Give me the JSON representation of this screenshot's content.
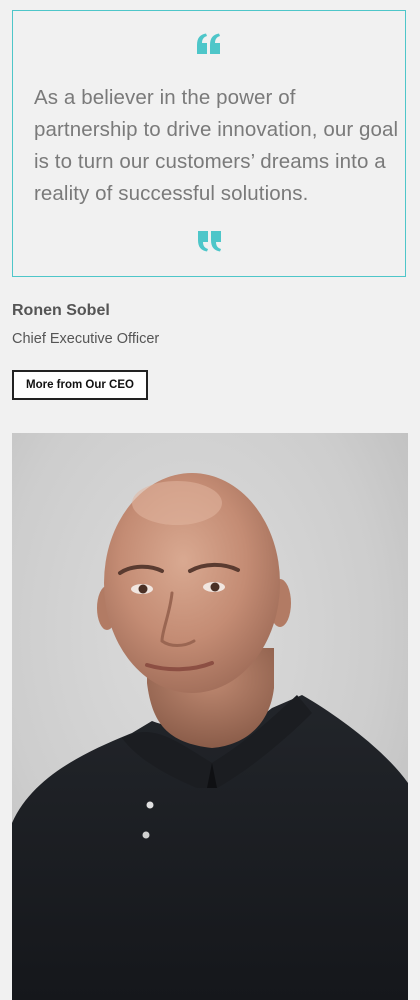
{
  "quote": {
    "text": "As a believer in the power of partnership to drive innovation, our goal is to turn our customers’ dreams into a reality of successful solutions.",
    "accent_color": "#4ec6c9"
  },
  "person": {
    "name": "Ronen Sobel",
    "title": "Chief Executive Officer"
  },
  "cta": {
    "label": "More from Our CEO"
  },
  "icons": {
    "open_quote": "open-quote-icon",
    "close_quote": "close-quote-icon"
  }
}
